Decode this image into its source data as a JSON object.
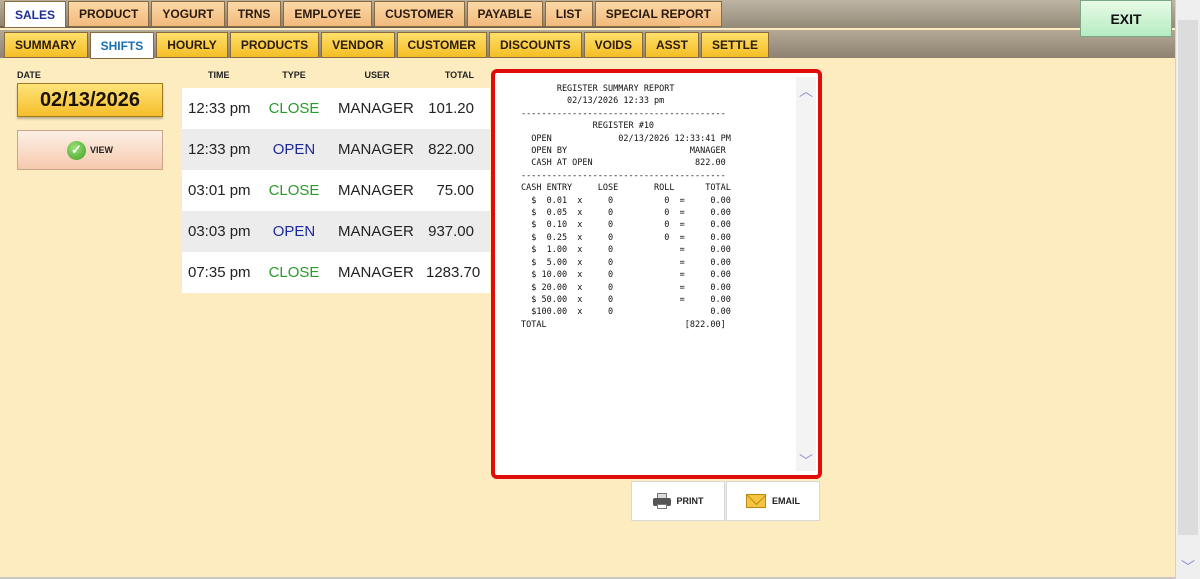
{
  "main_tabs": [
    {
      "label": "SALES",
      "active": true
    },
    {
      "label": "PRODUCT",
      "active": false
    },
    {
      "label": "YOGURT",
      "active": false
    },
    {
      "label": "TRNS",
      "active": false
    },
    {
      "label": "EMPLOYEE",
      "active": false
    },
    {
      "label": "CUSTOMER",
      "active": false
    },
    {
      "label": "PAYABLE",
      "active": false
    },
    {
      "label": "LIST",
      "active": false
    },
    {
      "label": "SPECIAL REPORT",
      "active": false
    }
  ],
  "sub_tabs": [
    {
      "label": "SUMMARY",
      "active": false
    },
    {
      "label": "SHIFTS",
      "active": true
    },
    {
      "label": "HOURLY",
      "active": false
    },
    {
      "label": "PRODUCTS",
      "active": false
    },
    {
      "label": "VENDOR",
      "active": false
    },
    {
      "label": "CUSTOMER",
      "active": false
    },
    {
      "label": "DISCOUNTS",
      "active": false
    },
    {
      "label": "VOIDS",
      "active": false
    },
    {
      "label": "ASST",
      "active": false
    },
    {
      "label": "SETTLE",
      "active": false
    }
  ],
  "exit_label": "EXIT",
  "date": {
    "label": "DATE",
    "value": "02/13/2026"
  },
  "view_label": "VIEW",
  "shifts": {
    "columns": [
      "TIME",
      "TYPE",
      "USER",
      "TOTAL"
    ],
    "rows": [
      {
        "time": "12:33 pm",
        "type": "CLOSE",
        "user": "MANAGER",
        "total": "101.20"
      },
      {
        "time": "12:33 pm",
        "type": "OPEN",
        "user": "MANAGER",
        "total": "822.00"
      },
      {
        "time": "03:01 pm",
        "type": "CLOSE",
        "user": "MANAGER",
        "total": "75.00"
      },
      {
        "time": "03:03 pm",
        "type": "OPEN",
        "user": "MANAGER",
        "total": "937.00"
      },
      {
        "time": "07:35 pm",
        "type": "CLOSE",
        "user": "MANAGER",
        "total": "1283.70"
      }
    ]
  },
  "report_lines": [
    "       REGISTER SUMMARY REPORT",
    "         02/13/2026 12:33 pm",
    "----------------------------------------",
    "              REGISTER #10",
    "  OPEN             02/13/2026 12:33:41 PM",
    "  OPEN BY                        MANAGER",
    "  CASH AT OPEN                    822.00",
    "----------------------------------------",
    "CASH ENTRY     LOSE       ROLL      TOTAL",
    "  $  0.01  x     0          0  =     0.00",
    "  $  0.05  x     0          0  =     0.00",
    "  $  0.10  x     0          0  =     0.00",
    "  $  0.25  x     0          0  =     0.00",
    "  $  1.00  x     0             =     0.00",
    "  $  5.00  x     0             =     0.00",
    "  $ 10.00  x     0             =     0.00",
    "  $ 20.00  x     0             =     0.00",
    "  $ 50.00  x     0             =     0.00",
    "  $100.00  x     0                   0.00",
    "TOTAL                           [822.00]"
  ],
  "print_label": "PRINT",
  "email_label": "EMAIL"
}
